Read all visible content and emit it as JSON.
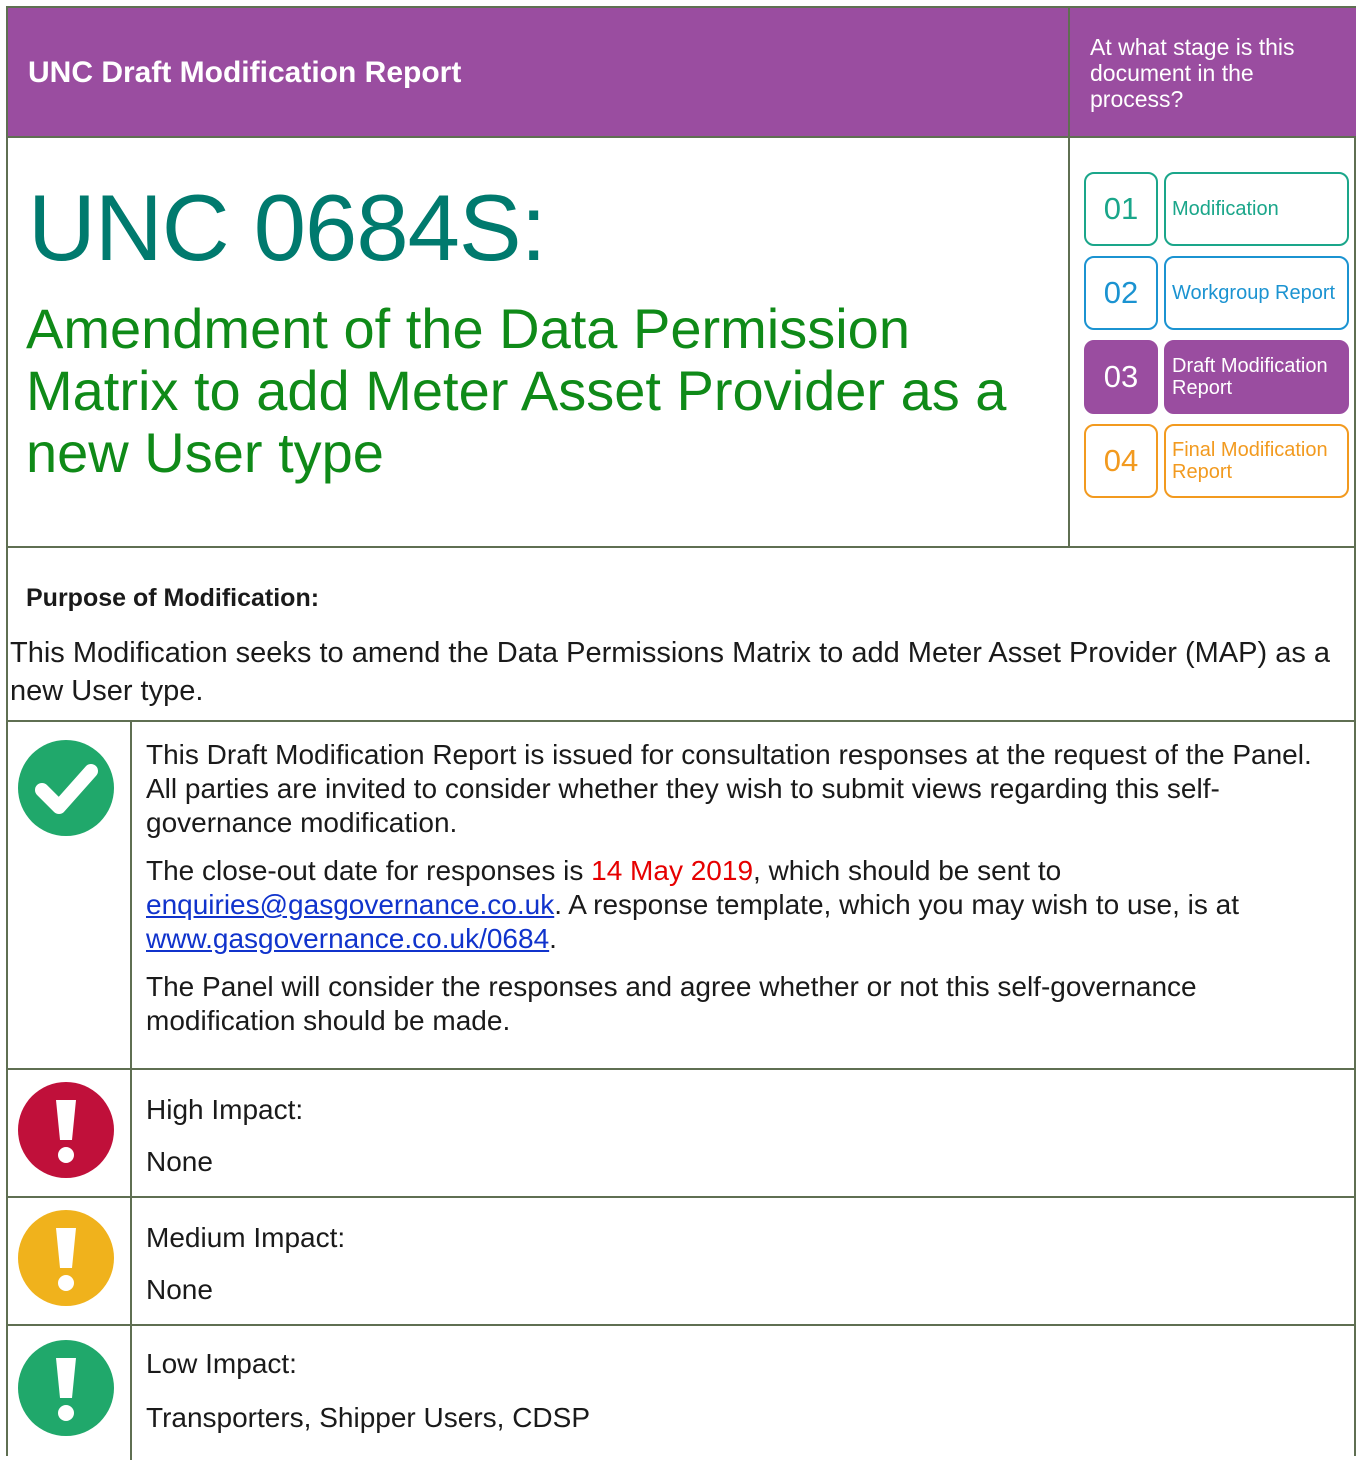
{
  "header": {
    "title": "UNC Draft Modification Report",
    "stage_question": "At what stage is this document in the process?"
  },
  "modification": {
    "number": "UNC 0684S:",
    "title": "Amendment of the Data Permission Matrix to add Meter Asset Provider as a new User type"
  },
  "stages": [
    {
      "num": "01",
      "label": "Modification",
      "color": "#1aa68a",
      "active": false
    },
    {
      "num": "02",
      "label": "Workgroup Report",
      "color": "#1b93d1",
      "active": false
    },
    {
      "num": "03",
      "label": "Draft Modification Report",
      "color": "#9a4da0",
      "active": true
    },
    {
      "num": "04",
      "label": "Final Modification Report",
      "color": "#f29a1f",
      "active": false
    }
  ],
  "purpose": {
    "heading": "Purpose of Modification:",
    "text": "This Modification seeks to amend the Data Permissions Matrix to add Meter Asset Provider (MAP) as a new User type."
  },
  "consultation": {
    "icon": "check-icon",
    "color": "#20a86b",
    "para1": "This Draft Modification Report is issued for consultation responses at the request of the Panel. All parties are invited to consider whether they wish to submit views regarding this self-governance modification.",
    "para2_before": "The close-out date for responses is ",
    "close_date": "14 May 2019",
    "para2_middle": ", which should be sent to ",
    "email": "enquiries@gasgovernance.co.uk",
    "para2_after_email": ".  A response template, which you may wish to use, is at ",
    "url": "www.gasgovernance.co.uk/0684",
    "para2_end": ".",
    "para3": "The Panel will consider the responses and agree whether or not this self-governance modification should be made."
  },
  "impacts": {
    "high": {
      "label": "High Impact:",
      "value": "None",
      "color": "#c0103a",
      "icon": "exclamation-icon"
    },
    "medium": {
      "label": "Medium Impact:",
      "value": "None",
      "color": "#f0b21c",
      "icon": "exclamation-icon"
    },
    "low": {
      "label": "Low Impact:",
      "value": "Transporters, Shipper Users, CDSP",
      "color": "#20a86b",
      "icon": "exclamation-icon"
    }
  }
}
